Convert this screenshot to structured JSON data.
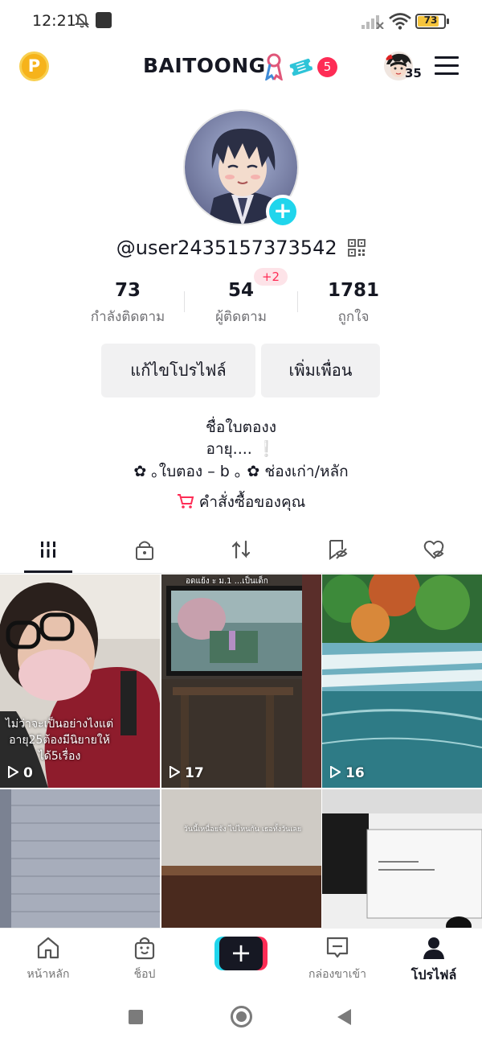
{
  "status_bar": {
    "time": "12:21",
    "battery": "73",
    "icons": [
      "mute-icon",
      "app-notification-icon",
      "signal-off-icon",
      "wifi-icon",
      "battery-icon"
    ]
  },
  "header": {
    "coin_letter": "P",
    "title": "BAITOONG",
    "notification_count": "5",
    "mini_avatar_count": "35"
  },
  "profile": {
    "handle": "@user2435157373542",
    "stats": [
      {
        "value": "73",
        "label": "กำลังติดตาม"
      },
      {
        "value": "54",
        "label": "ผู้ติดตาม"
      },
      {
        "value": "1781",
        "label": "ถูกใจ"
      }
    ],
    "follower_delta": "+2",
    "edit_button": "แก้ไขโปรไฟล์",
    "add_friend_button": "เพิ่มเพื่อน",
    "bio": {
      "line1": "ชื่อใบตองง",
      "line2": "อายุ.... ❕",
      "line3": "✿   ｡ใบตอง – b  ｡  ✿ ช่องเก่า/หลัก"
    },
    "orders_label": "คำสั่งซื้อของคุณ"
  },
  "tabs": [
    "videos-grid-tab",
    "private-tab",
    "reposts-tab",
    "favorites-tab",
    "liked-tab"
  ],
  "videos": [
    {
      "views": "0",
      "caption": "ไม่ว่าจะเป็นอย่างไงแต่ อายุ25ต้องมีนิยายให้ ได้5เรื่อง"
    },
    {
      "views": "17",
      "caption": "อดแย้ง ะ ม.1 ...เป็นเด็ก"
    },
    {
      "views": "16",
      "caption": ""
    },
    {
      "views": "",
      "caption": ""
    },
    {
      "views": "",
      "caption": "วันนี้เหนื่อยจัง ไปไหนกัน เธอทั้งวันเลย"
    },
    {
      "views": "",
      "caption": ""
    }
  ],
  "bottom_nav": {
    "home": "หน้าหลัก",
    "shop": "ช็อป",
    "create": "+",
    "inbox": "กล่องขาเข้า",
    "profile": "โปรไฟล์"
  },
  "colors": {
    "accent_pink": "#fe2c55",
    "accent_cyan": "#20d5ec",
    "text": "#161823",
    "muted": "#6f6f73"
  }
}
